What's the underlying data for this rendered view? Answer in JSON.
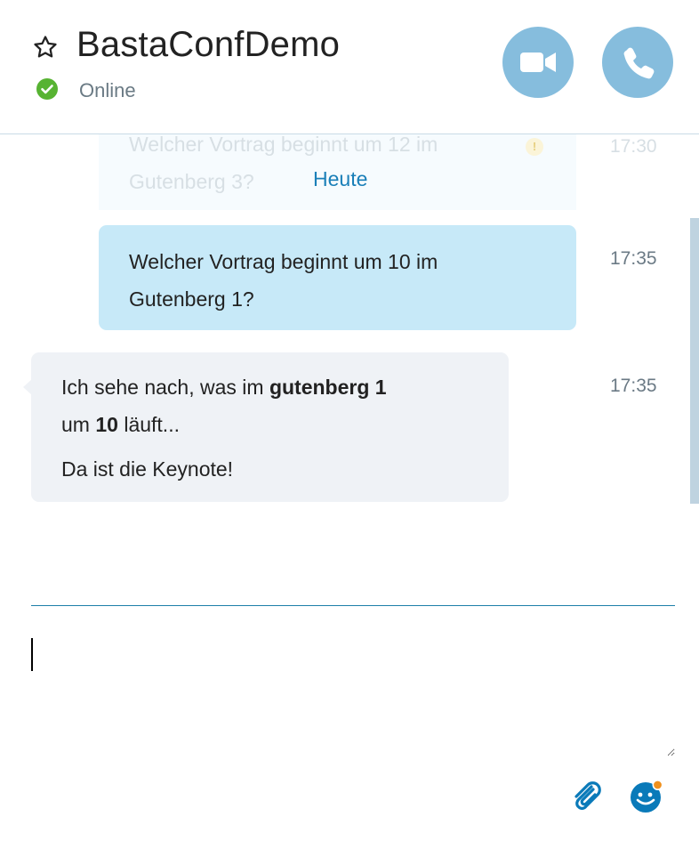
{
  "header": {
    "title": "BastaConfDemo",
    "status": "Online",
    "video_call_icon": "video-camera-icon",
    "audio_call_icon": "phone-icon",
    "favorite_icon": "star-outline-icon"
  },
  "chat": {
    "faded_message": {
      "text": "Welcher Vortrag beginnt um 12 im Gutenberg 3?",
      "time": "17:30",
      "warning_icon": "warning-icon"
    },
    "date_divider": "Heute",
    "outgoing": {
      "line1": "Welcher Vortrag beginnt um 10 im",
      "line2": "Gutenberg 1?",
      "time": "17:35"
    },
    "incoming": {
      "part1": "Ich sehe nach, was im ",
      "bold1": "gutenberg 1",
      "part2": "um ",
      "bold2": "10",
      "part3": " läuft...",
      "line2": "Da ist die Keynote!",
      "time": "17:35"
    }
  },
  "composer": {
    "value": "",
    "attach_icon": "paperclip-icon",
    "emoji_icon": "emoji-icon"
  },
  "colors": {
    "accent": "#1a7fb8",
    "call_button": "#86bddd",
    "outgoing_bubble": "#c7e9f8",
    "incoming_bubble": "#eff2f6",
    "status_online": "#57b332",
    "notification_dot": "#f0901c"
  }
}
